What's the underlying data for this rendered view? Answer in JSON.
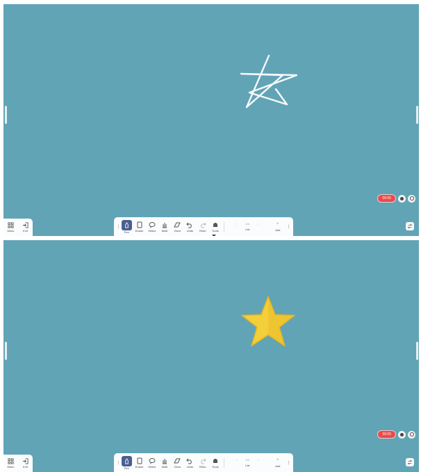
{
  "colors": {
    "canvas": "#61a4b6",
    "toolbar_bg": "#fbfcfd",
    "active_tool": "#4b5f92",
    "timer_red": "#ea4a4a",
    "star_yellow": "#f3cf3a"
  },
  "left_panel": {
    "menu_label": "Menu",
    "exit_label": "Exit"
  },
  "toolbar": {
    "pen_label": "Pen",
    "eraser_label": "Eraser",
    "select_label": "Select",
    "multi_label": "Multi",
    "clear_label": "Clear",
    "undo_label": "Undo",
    "redo_label": "Redo",
    "tools_label": "Tools",
    "page_indicator": "1/1",
    "list_label": "List",
    "add_label": "Add"
  },
  "recording": {
    "timer": "00:05"
  },
  "screens": [
    {
      "state": "hand-drawn-star-outline"
    },
    {
      "state": "recognized-yellow-star"
    }
  ]
}
